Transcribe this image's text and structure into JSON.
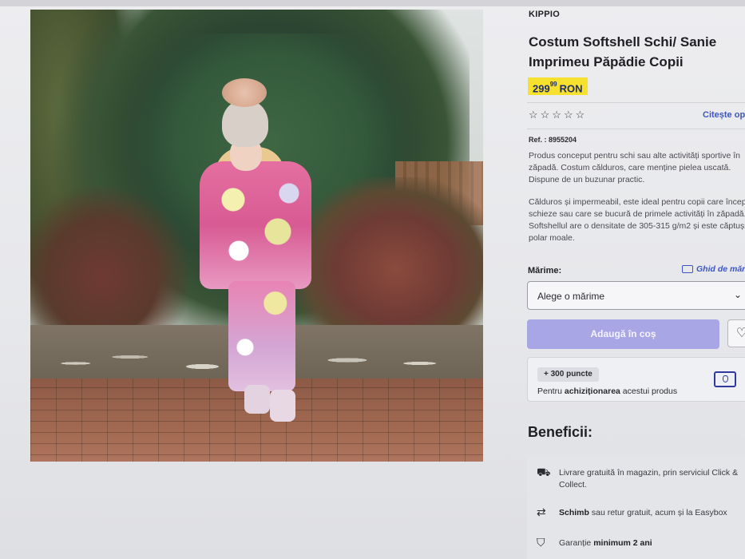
{
  "screen": {
    "top_strip_text": ""
  },
  "product": {
    "brand": "KIPPIO",
    "title": "Costum Softshell Schi/ Sanie Imprimeu Păpădie Copii",
    "price": {
      "integer": "299",
      "decimals": "99",
      "currency": "RON"
    },
    "rating": {
      "stars": 0,
      "max": 5,
      "stars_glyph": "☆☆☆☆☆",
      "reviews_link": "Citește opinii"
    },
    "ref": "Ref. : 8955204",
    "description_1": "Produs conceput pentru schi sau alte activități sportive în zăpadă. Costum călduros, care menține pielea uscată. Dispune de un buzunar practic.",
    "description_2": "Călduros și impermeabil, este ideal pentru copii care încep să schieze sau care se bucură de primele activități în zăpadă. Softshellul are o densitate de 305-315 g/m2 și este căptușit cu polar moale."
  },
  "size": {
    "label": "Mărime:",
    "guide_link": "Ghid de mărimi",
    "select_value": "Alege o mărime"
  },
  "actions": {
    "add_to_cart": "Adaugă în coș",
    "favorite_icon": "♡"
  },
  "points": {
    "badge": "+ 300 puncte",
    "text_pre": "Pentru ",
    "text_bold": "achiziționarea",
    "text_post": " acestui produs"
  },
  "benefits": {
    "title": "Beneficii:",
    "items": [
      {
        "icon": "store-icon",
        "glyph": "⛟",
        "pre": "Livrare gratuită în magazin, prin serviciul Click & Collect.",
        "bold": "",
        "post": ""
      },
      {
        "icon": "exchange-icon",
        "glyph": "⇄",
        "pre": "",
        "bold": "Schimb",
        "post": " sau retur gratuit, acum și la Easybox"
      },
      {
        "icon": "shield-icon",
        "glyph": "⛉",
        "pre": "Garanție ",
        "bold": "minimum 2 ani",
        "post": ""
      }
    ]
  },
  "colors": {
    "accent": "#3d55c4",
    "price_bg": "#f6e12e",
    "cart_btn": "#a9a6e6"
  }
}
